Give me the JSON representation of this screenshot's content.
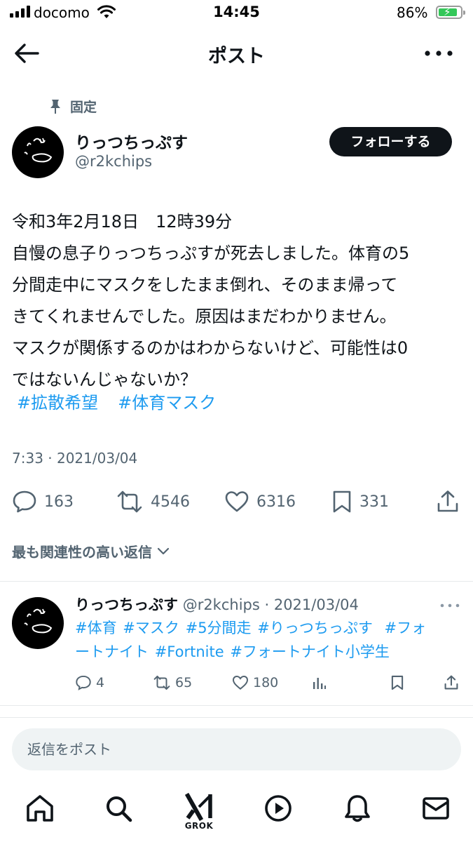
{
  "status_bar": {
    "carrier": "docomo",
    "time": "14:45",
    "battery_percent": "86%",
    "battery_level": 0.86,
    "charging": true
  },
  "nav": {
    "title": "ポスト",
    "back_icon": "arrow-left-icon",
    "more_icon": "more-horizontal-icon"
  },
  "post": {
    "pinned_label": "固定",
    "author_name": "りっつちっぷす",
    "author_handle": "@r2kchips",
    "follow_label": "フォローする",
    "body_lines": [
      "令和3年2月18日　12時39分",
      "自慢の息子りっつちっぷすが死去しました。体育の5",
      "分間走中にマスクをしたまま倒れ、そのまま帰って",
      "きてくれませんでした。原因はまだわかりません。",
      "マスクが関係するのかはわからないけど、可能性は0",
      "ではないんじゃないか？"
    ],
    "hashtags": [
      "#拡散希望",
      "#体育マスク"
    ],
    "timestamp": "7:33 · 2021/03/04",
    "stats": {
      "replies": "163",
      "reposts": "4546",
      "likes": "6316",
      "bookmarks": "331"
    }
  },
  "sort_label": "最も関連性の高い返信",
  "reply": {
    "author_name": "りっつちっぷす",
    "meta": "@r2kchips · 2021/03/04",
    "tags_line1": [
      "#体育",
      "#マスク",
      "#5分間走",
      "#りっつちっぷす",
      "#フォ"
    ],
    "tags_line2": [
      "ートナイト",
      "#Fortnite",
      "#フォートナイト小学生"
    ],
    "stats": {
      "replies": "4",
      "reposts": "65",
      "likes": "180"
    }
  },
  "reply_input": {
    "placeholder": "返信をポスト"
  },
  "tabbar": {
    "grok_label": "GROK",
    "items": [
      "home-icon",
      "search-icon",
      "grok-icon",
      "video-icon",
      "notifications-icon",
      "messages-icon"
    ]
  },
  "colors": {
    "text": "#0f1419",
    "secondary": "#536471",
    "link": "#1d9bf0",
    "divider": "#e6e9eb",
    "battery": "#34c759"
  }
}
